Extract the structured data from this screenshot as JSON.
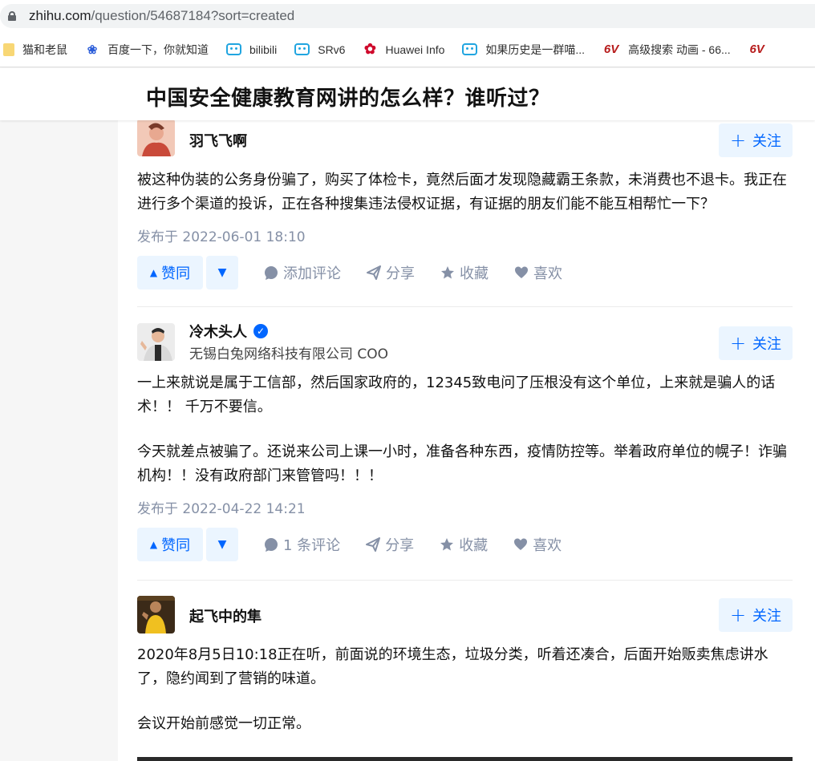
{
  "browser": {
    "url_host": "zhihu.com",
    "url_path": "/question/54687184?sort=created",
    "bookmarks": [
      {
        "label": "猫和老鼠",
        "icon": "folder-icon"
      },
      {
        "label": "百度一下，你就知道",
        "icon": "baidu-paw-icon"
      },
      {
        "label": "bilibili",
        "icon": "bilibili-tv-icon"
      },
      {
        "label": "SRv6",
        "icon": "bilibili-tv-icon"
      },
      {
        "label": "Huawei Info",
        "icon": "huawei-logo-icon"
      },
      {
        "label": "如果历史是一群喵...",
        "icon": "bilibili-tv-icon"
      },
      {
        "label": "高级搜索 动画 - 66...",
        "icon": "6v-logo-icon"
      }
    ],
    "bookmark_overflow_text": "6V"
  },
  "question": {
    "title": "中国安全健康教育网讲的怎么样？谁听过？"
  },
  "labels": {
    "follow": "关注",
    "upvote": "赞同",
    "share": "分享",
    "collect": "收藏",
    "like": "喜欢",
    "date_prefix": "发布于"
  },
  "answers": [
    {
      "author": "羽飞飞啊",
      "headline": "",
      "verified": false,
      "paragraphs": [
        "被这种伪装的公务身份骗了，购买了体检卡，竟然后面才发现隐藏霸王条款，未消费也不退卡。我正在进行多个渠道的投诉，正在各种搜集违法侵权证据，有证据的朋友们能不能互相帮忙一下？"
      ],
      "date": "发布于 2022-06-01 18:10",
      "comment_label": "添加评论"
    },
    {
      "author": "冷木头人",
      "headline": "无锡白兔网络科技有限公司 COO",
      "verified": true,
      "paragraphs": [
        "一上来就说是属于工信部，然后国家政府的，12345致电问了压根没有这个单位，上来就是骗人的话术！！ 千万不要信。",
        "今天就差点被骗了。还说来公司上课一小时，准备各种东西，疫情防控等。举着政府单位的幌子！诈骗机构！！没有政府部门来管管吗！！！"
      ],
      "date": "发布于 2022-04-22 14:21",
      "comment_label": "1 条评论"
    },
    {
      "author": "起飞中的隼",
      "headline": "",
      "verified": false,
      "paragraphs": [
        "2020年8月5日10:18正在听，前面说的环境生态，垃圾分类，听着还凑合，后面开始贩卖焦虑讲水了，隐约闻到了营销的味道。",
        "会议开始前感觉一切正常。"
      ]
    }
  ],
  "colors": {
    "accent": "#0066ff",
    "accent_bg": "#ebf5ff",
    "meta": "#8590a6",
    "page_bg": "#f6f6f6"
  }
}
